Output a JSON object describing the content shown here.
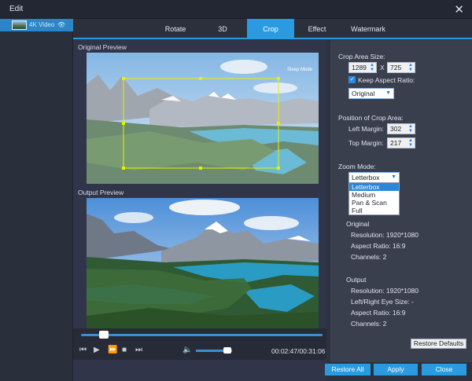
{
  "window": {
    "title": "Edit",
    "close_icon": "close-icon"
  },
  "file": {
    "name": "4K Video",
    "eye_icon": "eye-icon"
  },
  "tabs": [
    {
      "label": "Rotate",
      "active": false
    },
    {
      "label": "3D",
      "active": false
    },
    {
      "label": "Crop",
      "active": true
    },
    {
      "label": "Effect",
      "active": false
    },
    {
      "label": "Watermark",
      "active": false
    }
  ],
  "preview": {
    "original_label": "Original Preview",
    "output_label": "Output Preview",
    "watermark_text": "Sleep Mode"
  },
  "player": {
    "time": "00:02:47/00:31:06",
    "progress_fraction": 0.07,
    "volume_fraction": 0.78
  },
  "crop": {
    "area_size_label": "Crop Area Size:",
    "width": "1289",
    "height": "725",
    "x_sep": "X",
    "keep_aspect_label": "Keep Aspect Ratio:",
    "keep_aspect_checked": true,
    "aspect_value": "Original",
    "position_label": "Position of Crop Area:",
    "left_margin_label": "Left Margin:",
    "left_margin": "302",
    "top_margin_label": "Top Margin:",
    "top_margin": "217",
    "zoom_label": "Zoom Mode:",
    "zoom_value": "Letterbox",
    "zoom_options": [
      "Letterbox",
      "Medium",
      "Pan & Scan",
      "Full"
    ]
  },
  "info": {
    "original_label": "Original",
    "orig_resolution": "Resolution: 1920*1080",
    "orig_aspect": "Aspect Ratio: 16:9",
    "orig_channels": "Channels: 2",
    "output_label": "Output",
    "out_resolution": "Resolution: 1920*1080",
    "out_eye_size": "Left/Right Eye Size: -",
    "out_aspect": "Aspect Ratio: 16:9",
    "out_channels": "Channels: 2"
  },
  "buttons": {
    "restore_defaults": "Restore Defaults",
    "restore_all": "Restore All",
    "apply": "Apply",
    "close": "Close"
  },
  "colors": {
    "accent": "#2a9be0",
    "crop_frame": "#e8f000"
  }
}
